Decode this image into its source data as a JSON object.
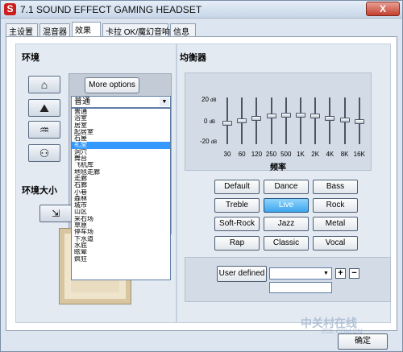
{
  "window": {
    "title": "7.1 SOUND EFFECT GAMING HEADSET",
    "logo_glyph": "S",
    "close_glyph": "X"
  },
  "tabs": [
    {
      "label": "主设置"
    },
    {
      "label": "混音器"
    },
    {
      "label": "效果"
    },
    {
      "label": "卡拉 OK/魔幻音响"
    },
    {
      "label": "信息"
    }
  ],
  "active_tab": "效果",
  "environment": {
    "title": "环境",
    "more_options_label": "More options",
    "selected": "普通",
    "arrow_glyph": "▼",
    "options": [
      "普通",
      "浴室",
      "居室",
      "起居室",
      "石屋",
      "礼堂",
      "洞穴",
      "舞台",
      "飞机库",
      "地毯走廊",
      "走廊",
      "石廊",
      "小巷",
      "森林",
      "城市",
      "山区",
      "采石场",
      "草原",
      "停车场",
      "下水道",
      "水底",
      "眩晕",
      "疯狂"
    ],
    "highlighted": "礼堂",
    "icons": [
      "house-icon",
      "room-icon",
      "canyon-icon",
      "hall-icon"
    ]
  },
  "env_size": {
    "title": "环境大小",
    "button_glyph": "⇲"
  },
  "equalizer": {
    "title": "均衡器",
    "db_labels": [
      {
        "value": "20",
        "unit": "dB"
      },
      {
        "value": "0",
        "unit": "dB"
      },
      {
        "value": "-20",
        "unit": "dB"
      }
    ],
    "bands": [
      "30",
      "60",
      "120",
      "250",
      "500",
      "1K",
      "2K",
      "4K",
      "8K",
      "16K"
    ],
    "gains_db": [
      -2,
      0,
      2,
      4,
      5,
      5,
      4,
      2,
      1,
      -1
    ],
    "freq_axis_label": "频率",
    "presets": [
      "Default",
      "Dance",
      "Bass",
      "Treble",
      "Live",
      "Rock",
      "Soft-Rock",
      "Jazz",
      "Metal",
      "Rap",
      "Classic",
      "Vocal"
    ],
    "active_preset": "Live",
    "user_defined_label": "User defined",
    "user_defined_value": "",
    "plus_glyph": "+",
    "minus_glyph": "−"
  },
  "footer": {
    "ok_label": "确定"
  },
  "watermark": {
    "text": "中关村在线",
    "sub": "ZOL.COM.CN"
  },
  "colors": {
    "active_preset": "#3ea6ee",
    "list_highlight": "#3399ff",
    "close_button": "#c4402f"
  }
}
